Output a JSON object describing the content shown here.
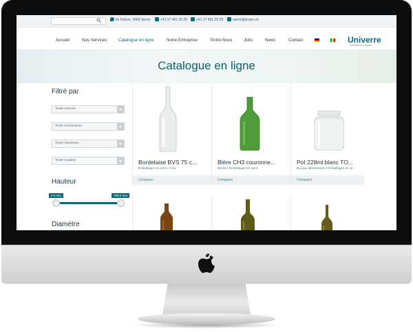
{
  "topbar": {
    "address": "Ile Falcon, 3960 Sierre",
    "phone": "+41 27 451 25 25",
    "fax": "+41 27 451 25 29",
    "email": "sierre@prowe.ch"
  },
  "nav": {
    "items": [
      "Accueil",
      "Nos Services",
      "Catalogue en ligne",
      "Notre Entreprise",
      "Entre-Nous",
      "Jobs",
      "News",
      "Contact"
    ],
    "active": "Catalogue en ligne"
  },
  "logo": {
    "name": "Univerre",
    "tagline": "excellence in glass"
  },
  "hero": {
    "title": "Catalogue en ligne"
  },
  "filters": {
    "heading": "Filtré par",
    "selects": [
      "Toute Gamme",
      "Toute Contenance",
      "Toute Ouverture",
      "Toute Couleur"
    ],
    "height_heading": "Hauteur",
    "height_min": "0.0 mm",
    "height_max": "759.0 mm",
    "diameter_heading": "Diamètre"
  },
  "products": [
    {
      "title": "Bordelaise BVS 75 c...",
      "category": "Emballages en verre | Vins",
      "compare": "Comparer",
      "glass": "clear"
    },
    {
      "title": "Bière CH3 couronne...",
      "category": "Bières | Emballages en verre",
      "compare": "Comparer",
      "glass": "green"
    },
    {
      "title": "Pot 228ml blanc TO...",
      "category": "Bocaux alimentaires | Emballages en ve",
      "compare": "Comparer",
      "glass": "clear"
    },
    {
      "glass": "amber"
    },
    {
      "glass": "olive"
    },
    {
      "glass": "olive"
    }
  ],
  "colors": {
    "accent": "#0b6b78",
    "glass_clear": "#e7eced",
    "glass_green": "#4f9a3a",
    "glass_amber": "#7a4714",
    "glass_olive": "#5d5a1a"
  }
}
